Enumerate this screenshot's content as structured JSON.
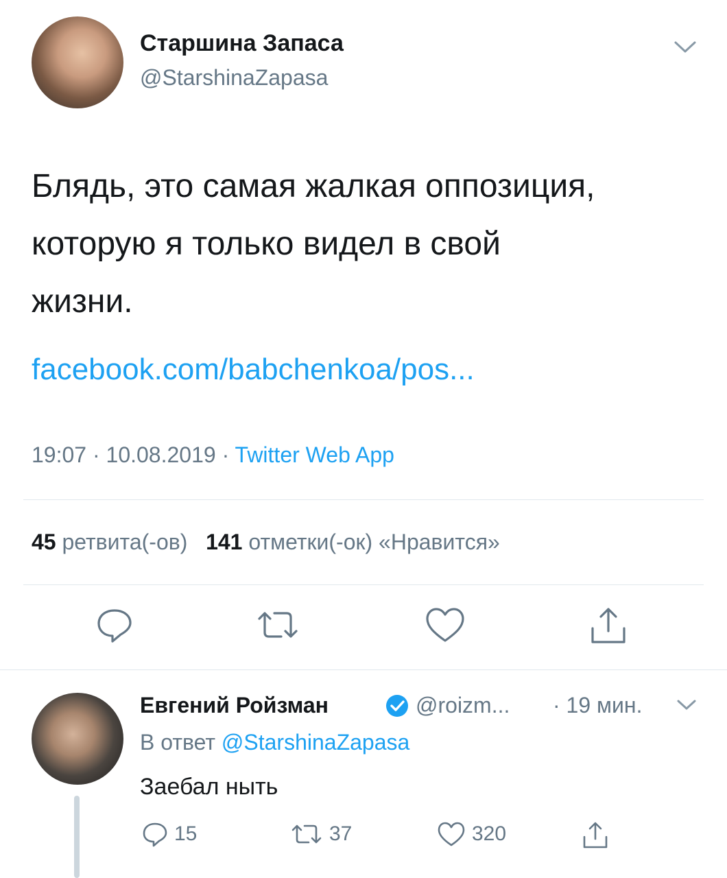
{
  "tweet": {
    "author_name": "Старшина Запаса",
    "author_handle": "@StarshinaZapasa",
    "text_line1": "Блядь, это самая жалкая оппозиция,",
    "text_line2": "которую я только видел в свой",
    "text_line3": "жизни.",
    "link": "facebook.com/babchenkoa/pos...",
    "time": "19:07",
    "date": "10.08.2019",
    "source": "Twitter Web App",
    "retweets_count": "45",
    "retweets_label": "ретвита(-ов)",
    "likes_count": "141",
    "likes_label": "отметки(-ок) «Нравится»"
  },
  "reply": {
    "author_name": "Евгений Ройзман",
    "author_handle": "@roizm...",
    "time": "· 19 мин.",
    "reply_prefix": "В ответ",
    "reply_mention": "@StarshinaZapasa",
    "text": "Заебал ныть",
    "replies": "15",
    "retweets": "37",
    "likes": "320"
  },
  "colors": {
    "link": "#1da1f2",
    "muted": "#657786",
    "divider": "#e1e8ed"
  },
  "icons": [
    "chevron-down-icon",
    "reply-icon",
    "retweet-icon",
    "like-icon",
    "share-icon",
    "verified-icon"
  ]
}
